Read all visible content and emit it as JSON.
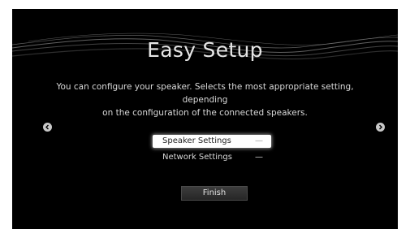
{
  "title": "Easy Setup",
  "description_line1": "You can configure your speaker. Selects the most appropriate setting, depending",
  "description_line2": "on the configuration of the connected speakers.",
  "menu": {
    "items": [
      {
        "label": "Speaker Settings",
        "value": "—",
        "selected": true
      },
      {
        "label": "Network Settings",
        "value": "—",
        "selected": false
      }
    ]
  },
  "finish_label": "Finish",
  "icons": {
    "left": "chevron-left-circle-icon",
    "right": "chevron-right-circle-icon"
  },
  "colors": {
    "background": "#000000",
    "text": "#d8d8d8",
    "selected_bg": "#ffffff"
  }
}
